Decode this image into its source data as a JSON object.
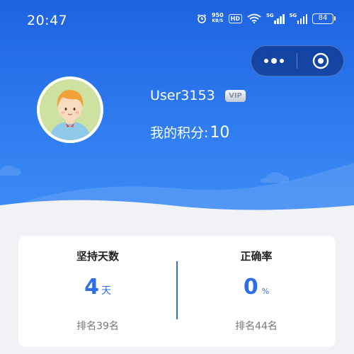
{
  "status_bar": {
    "time": "20:47",
    "net_speed_value": "950",
    "net_speed_unit": "KB/S",
    "hd_label": "HD",
    "sim1_label": "5G",
    "sim2_label": "5G",
    "battery": "84"
  },
  "profile": {
    "username": "User3153",
    "vip_badge": "VIP",
    "points_label": "我的积分:",
    "points_value": "10"
  },
  "stats": {
    "streak": {
      "title": "坚持天数",
      "value": "4",
      "unit": "天",
      "rank": "排名39名"
    },
    "accuracy": {
      "title": "正确率",
      "value": "0",
      "unit": "%",
      "rank": "排名44名"
    }
  },
  "colors": {
    "header_blue": "#1f62e0",
    "accent_blue": "#2f6fe5",
    "page_bg": "#f1f2f6"
  },
  "icons": {
    "capsule_more": "more-dots-icon",
    "capsule_close": "target-circle-icon",
    "alarm": "alarm-clock-icon",
    "wifi": "wifi-icon"
  }
}
